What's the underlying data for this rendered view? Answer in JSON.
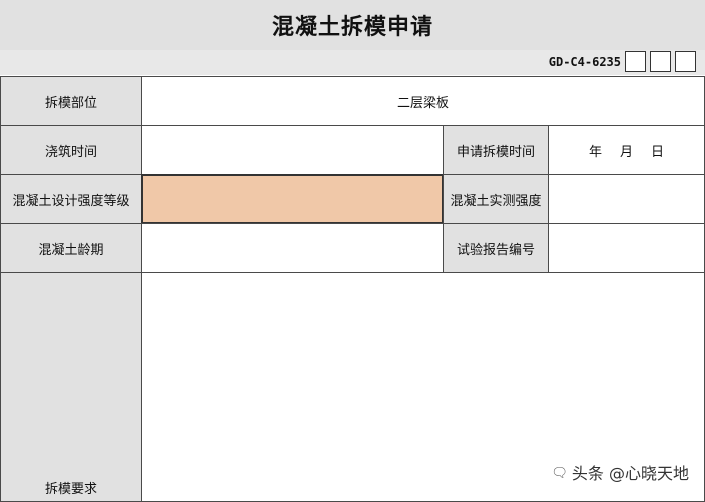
{
  "form": {
    "title": "混凝土拆模申请",
    "code": "GD-C4-6235"
  },
  "rows": {
    "part_label": "拆模部位",
    "part_value": "二层梁板",
    "pour_time_label": "浇筑时间",
    "pour_time_value": "",
    "apply_time_label": "申请拆模时间",
    "apply_time_year": "年",
    "apply_time_month": "月",
    "apply_time_day": "日",
    "design_strength_label": "混凝土设计强度等级",
    "design_strength_value": "",
    "actual_strength_label": "混凝土实测强度",
    "actual_strength_value": "",
    "age_label": "混凝土龄期",
    "age_value": "",
    "report_no_label": "试验报告编号",
    "report_no_value": "",
    "requirements_label": "拆模要求",
    "requirements_value": ""
  },
  "watermark": {
    "text": "头条 @心晓天地",
    "icon": "speech-bubble-icon"
  }
}
